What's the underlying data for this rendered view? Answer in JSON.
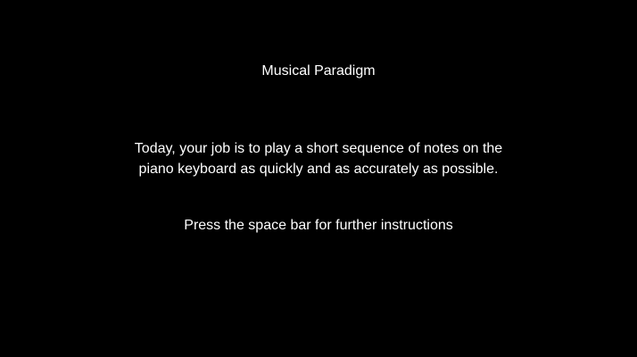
{
  "screen": {
    "title": "Musical Paradigm",
    "instructions": {
      "line1": "Today, your job is to play a short sequence of notes on the",
      "line2": "piano keyboard as quickly and as accurately as possible."
    },
    "prompt": "Press the space bar for further instructions"
  },
  "colors": {
    "background": "#000000",
    "text": "#ffffff"
  }
}
